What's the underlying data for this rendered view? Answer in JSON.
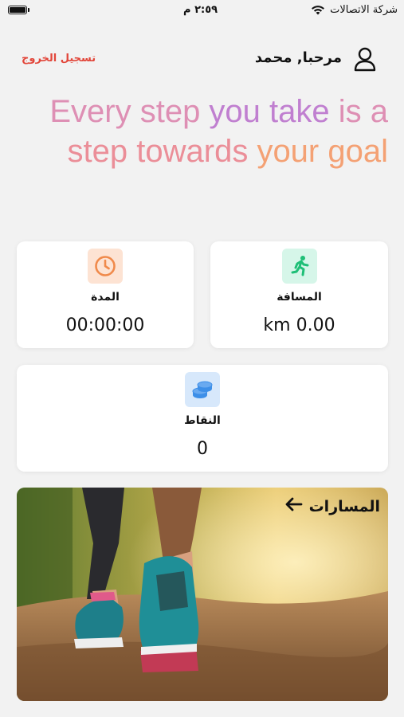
{
  "status_bar": {
    "carrier": "شركة الاتصالات",
    "time": "٢:٥٩ م",
    "icons": [
      "wifi-icon",
      "battery-icon"
    ]
  },
  "header": {
    "logout_label": "تسجيل الخروج",
    "greeting": "مرحبا, محمد",
    "user_icon": "user-icon"
  },
  "motto": {
    "line1": [
      "Every step ",
      "you take ",
      "is a"
    ],
    "line2": [
      "step towards ",
      "your goal"
    ]
  },
  "stats": {
    "duration": {
      "icon": "clock-icon",
      "label": "المدة",
      "value": "00:00:00"
    },
    "distance": {
      "icon": "runner-icon",
      "label": "المسافة",
      "value": "km 0.00"
    },
    "points": {
      "icon": "coins-icon",
      "label": "النقاط",
      "value": "0"
    }
  },
  "routes": {
    "label": "المسارات",
    "icon": "arrow-left-icon"
  },
  "colors": {
    "logout": "#e2463a",
    "motto_pink": "#de8fb4",
    "motto_purple": "#c07fd0",
    "motto_rose": "#eb8e98",
    "motto_orange": "#f4a174",
    "clock_bg": "#fde3d3",
    "clock_fg": "#f08a4b",
    "runner_bg": "#d6f6e9",
    "runner_fg": "#1fbf77",
    "coins_bg": "#d7e8fb",
    "coins_fg": "#3d8fe8"
  }
}
